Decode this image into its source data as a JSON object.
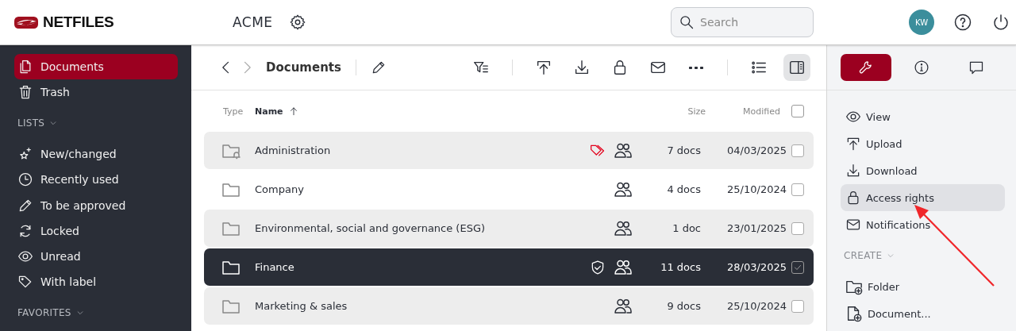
{
  "header": {
    "logo": "NETFILES",
    "workspace": "ACME",
    "search": {
      "placeholder": "Search"
    },
    "avatar": "KW"
  },
  "sidebar": {
    "items": [
      {
        "label": "Documents",
        "selected": true
      },
      {
        "label": "Trash",
        "selected": false
      }
    ],
    "lists_heading": "LISTS",
    "lists": [
      {
        "label": "New/changed",
        "selected": false
      },
      {
        "label": "Recently used",
        "selected": false
      },
      {
        "label": "To be approved",
        "selected": false
      },
      {
        "label": "Locked",
        "selected": false
      },
      {
        "label": "Unread",
        "selected": false
      },
      {
        "label": "With label",
        "selected": false
      }
    ],
    "favorites_heading": "FAVORITES"
  },
  "toolbar": {
    "breadcrumb": "Documents",
    "view_toggles": [
      {
        "selected": false
      },
      {
        "selected": true
      }
    ]
  },
  "table": {
    "columns": [
      "Type",
      "Name",
      "Size",
      "Modified"
    ],
    "all_checked": false,
    "rows": [
      {
        "name": "Administration",
        "notifications": true,
        "labeled": true,
        "protected": false,
        "size": "7 docs",
        "modified": "04/03/2025",
        "selected": false,
        "checked": false
      },
      {
        "name": "Company",
        "notifications": false,
        "labeled": false,
        "protected": false,
        "size": "4 docs",
        "modified": "25/10/2024",
        "selected": false,
        "checked": false
      },
      {
        "name": "Environmental, social and governance (ESG)",
        "notifications": false,
        "labeled": false,
        "protected": false,
        "size": "1 doc",
        "modified": "23/01/2025",
        "selected": false,
        "checked": false
      },
      {
        "name": "Finance",
        "notifications": false,
        "labeled": false,
        "protected": true,
        "size": "11 docs",
        "modified": "28/03/2025",
        "selected": true,
        "checked": true
      },
      {
        "name": "Marketing & sales",
        "notifications": false,
        "labeled": false,
        "protected": false,
        "size": "9 docs",
        "modified": "25/10/2024",
        "selected": false,
        "checked": false
      }
    ]
  },
  "panel": {
    "tabs": [
      {
        "selected": true
      },
      {
        "selected": false
      },
      {
        "selected": false
      }
    ],
    "actions": [
      {
        "label": "View",
        "selected": false
      },
      {
        "label": "Upload",
        "selected": false
      },
      {
        "label": "Download",
        "selected": false
      },
      {
        "label": "Access rights",
        "selected": true
      },
      {
        "label": "Notifications",
        "selected": false
      }
    ],
    "create_heading": "CREATE",
    "create": [
      {
        "label": "Folder"
      },
      {
        "label": "Document..."
      }
    ]
  }
}
